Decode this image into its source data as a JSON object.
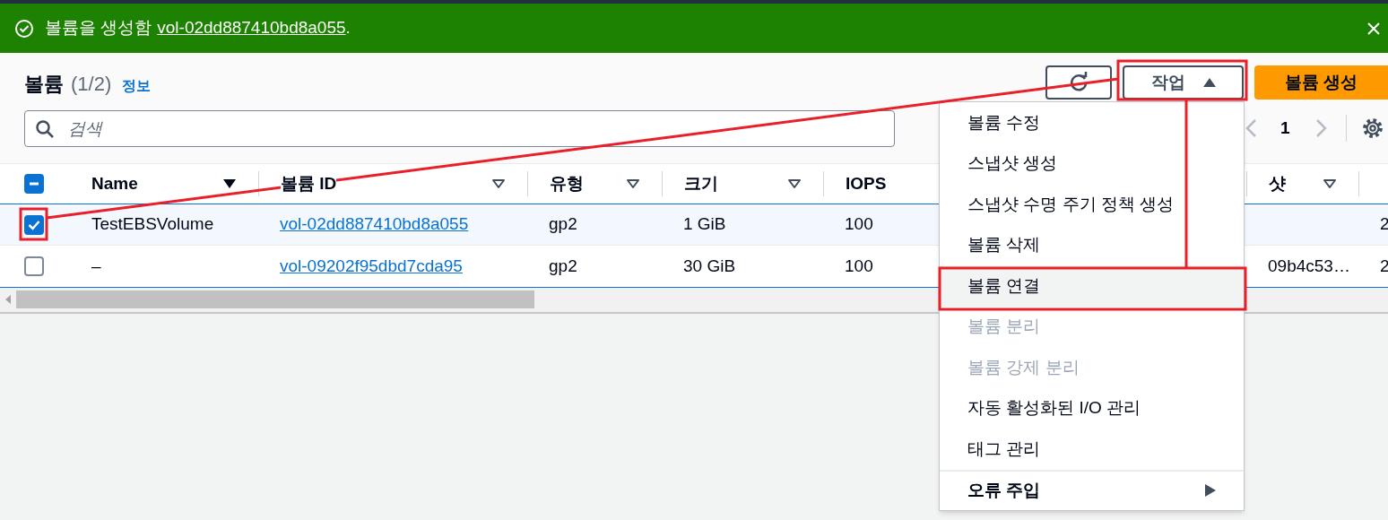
{
  "notification": {
    "message": "볼륨을 생성함",
    "link": "vol-02dd887410bd8a055",
    "suffix": "."
  },
  "header": {
    "title": "볼륨",
    "count": "(1/2)",
    "info": "정보"
  },
  "toolbar": {
    "actions_button": {
      "label": "작업",
      "expanded": true
    },
    "create_button": "볼륨 생성"
  },
  "search": {
    "placeholder": "검색"
  },
  "pagination": {
    "page": "1",
    "prev_disabled": true,
    "next_disabled": true
  },
  "table": {
    "select_all_partial": true,
    "columns": [
      {
        "label": "Name",
        "sortable": true,
        "sorted": true
      },
      {
        "label": "볼륨 ID",
        "sortable": true,
        "sorted": false
      },
      {
        "label": "유형",
        "sortable": true,
        "sorted": false
      },
      {
        "label": "크기",
        "sortable": true,
        "sorted": false
      },
      {
        "label": "IOPS"
      },
      {
        "label": "샷",
        "sortable": true,
        "sorted": false
      },
      {}
    ],
    "rows": [
      {
        "selected": true,
        "cells": [
          "TestEBSVolume",
          "vol-02dd887410bd8a055",
          "gp2",
          "1 GiB",
          "100",
          null,
          "2"
        ]
      },
      {
        "selected": false,
        "cells": [
          "–",
          "vol-09202f95dbd7cda95",
          "gp2",
          "30 GiB",
          "100",
          "09b4c53…",
          "2"
        ]
      }
    ]
  },
  "menu": {
    "items": [
      {
        "kind": "item",
        "label": "볼륨 수정",
        "disabled": false,
        "highlighted": false
      },
      {
        "kind": "item",
        "label": "스냅샷 생성",
        "disabled": false,
        "highlighted": false
      },
      {
        "kind": "item",
        "label": "스냅샷 수명 주기 정책 생성",
        "disabled": false,
        "highlighted": false
      },
      {
        "kind": "item",
        "label": "볼륨 삭제",
        "disabled": false,
        "highlighted": false
      },
      {
        "kind": "item",
        "label": "볼륨 연결",
        "disabled": false,
        "highlighted": true
      },
      {
        "kind": "item",
        "label": "볼륨 분리",
        "disabled": true,
        "highlighted": false
      },
      {
        "kind": "item",
        "label": "볼륨 강제 분리",
        "disabled": true,
        "highlighted": false
      },
      {
        "kind": "item",
        "label": "자동 활성화된 I/O 관리",
        "disabled": false,
        "highlighted": false
      },
      {
        "kind": "item",
        "label": "태그 관리",
        "disabled": false,
        "highlighted": false
      },
      {
        "kind": "submenu",
        "label": "오류 주입",
        "disabled": false,
        "highlighted": false
      }
    ]
  }
}
